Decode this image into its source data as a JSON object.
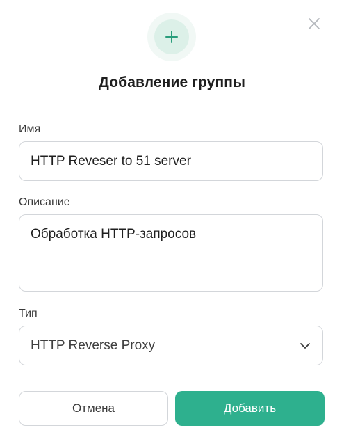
{
  "dialog": {
    "title": "Добавление группы",
    "icons": {
      "header": "plus-icon",
      "close": "close-icon",
      "dropdown": "chevron-down-icon"
    },
    "colors": {
      "accent": "#2eb08e",
      "icon_bg": "#dcf0e8",
      "border": "#d3d6da"
    }
  },
  "form": {
    "name": {
      "label": "Имя",
      "value": "HTTP Reveser to 51 server"
    },
    "description": {
      "label": "Описание",
      "value": "Обработка HTTP-запросов"
    },
    "type": {
      "label": "Тип",
      "value": "HTTP Reverse Proxy"
    }
  },
  "actions": {
    "cancel_label": "Отмена",
    "add_label": "Добавить"
  }
}
